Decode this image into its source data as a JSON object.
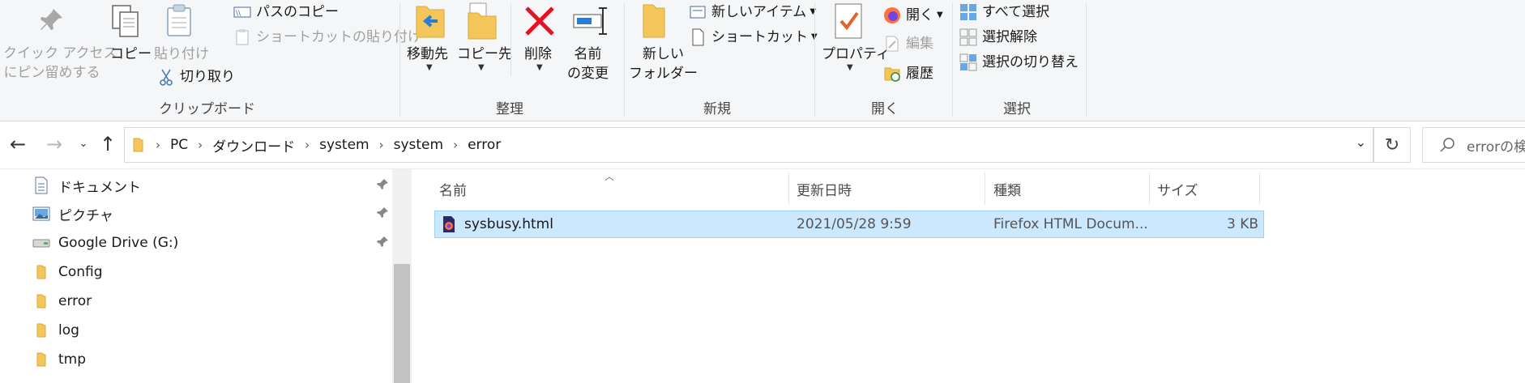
{
  "ribbon": {
    "clipboard": {
      "group_label": "クリップボード",
      "pin_label_1": "クイック アクセス",
      "pin_label_2": "にピン留めする",
      "copy": "コピー",
      "paste": "貼り付け",
      "copy_path": "パスのコピー",
      "paste_shortcut": "ショートカットの貼り付け",
      "cut": "切り取り"
    },
    "organize": {
      "group_label": "整理",
      "move_to": "移動先",
      "copy_to": "コピー先",
      "delete": "削除",
      "rename_1": "名前",
      "rename_2": "の変更"
    },
    "new": {
      "group_label": "新規",
      "new_folder_1": "新しい",
      "new_folder_2": "フォルダー",
      "new_item": "新しいアイテム",
      "shortcut": "ショートカット"
    },
    "open": {
      "group_label": "開く",
      "properties": "プロパティ",
      "open": "開く",
      "edit": "編集",
      "history": "履歴"
    },
    "select": {
      "group_label": "選択",
      "select_all": "すべて選択",
      "select_none": "選択解除",
      "invert": "選択の切り替え"
    }
  },
  "address": {
    "crumbs": [
      "PC",
      "ダウンロード",
      "system",
      "system",
      "error"
    ],
    "search_placeholder": "errorの検"
  },
  "nav": {
    "items": [
      {
        "label": "ドキュメント",
        "icon": "documents-icon",
        "pinned": true
      },
      {
        "label": "ピクチャ",
        "icon": "pictures-icon",
        "pinned": true
      },
      {
        "label": "Google Drive (G:)",
        "icon": "drive-icon",
        "pinned": true
      },
      {
        "label": "Config",
        "icon": "folder-icon",
        "pinned": false
      },
      {
        "label": "error",
        "icon": "folder-icon",
        "pinned": false
      },
      {
        "label": "log",
        "icon": "folder-icon",
        "pinned": false
      },
      {
        "label": "tmp",
        "icon": "folder-icon",
        "pinned": false
      }
    ]
  },
  "list": {
    "columns": {
      "name": "名前",
      "modified": "更新日時",
      "type": "種類",
      "size": "サイズ"
    },
    "rows": [
      {
        "name": "sysbusy.html",
        "modified": "2021/05/28 9:59",
        "type": "Firefox HTML Docum...",
        "size": "3 KB",
        "selected": true
      }
    ]
  }
}
